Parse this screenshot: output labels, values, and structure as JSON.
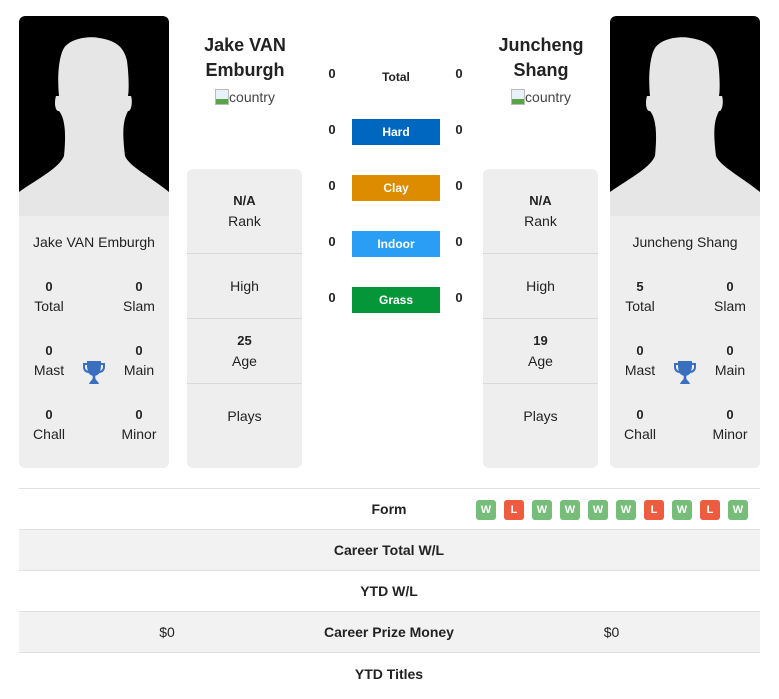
{
  "players": {
    "left": {
      "name": "Jake VAN Emburgh",
      "name_line1": "Jake VAN",
      "name_line2": "Emburgh",
      "country_alt": "country",
      "titles": {
        "total": {
          "value": "0",
          "label": "Total"
        },
        "slam": {
          "value": "0",
          "label": "Slam"
        },
        "mast": {
          "value": "0",
          "label": "Mast"
        },
        "main": {
          "value": "0",
          "label": "Main"
        },
        "chall": {
          "value": "0",
          "label": "Chall"
        },
        "minor": {
          "value": "0",
          "label": "Minor"
        }
      },
      "info": {
        "rank": {
          "value": "N/A",
          "label": "Rank"
        },
        "high": {
          "value": "",
          "label": "High"
        },
        "age": {
          "value": "25",
          "label": "Age"
        },
        "plays": {
          "value": "",
          "label": "Plays"
        }
      }
    },
    "right": {
      "name": "Juncheng Shang",
      "name_line1": "Juncheng",
      "name_line2": "Shang",
      "country_alt": "country",
      "titles": {
        "total": {
          "value": "5",
          "label": "Total"
        },
        "slam": {
          "value": "0",
          "label": "Slam"
        },
        "mast": {
          "value": "0",
          "label": "Mast"
        },
        "main": {
          "value": "0",
          "label": "Main"
        },
        "chall": {
          "value": "0",
          "label": "Chall"
        },
        "minor": {
          "value": "0",
          "label": "Minor"
        }
      },
      "info": {
        "rank": {
          "value": "N/A",
          "label": "Rank"
        },
        "high": {
          "value": "",
          "label": "High"
        },
        "age": {
          "value": "19",
          "label": "Age"
        },
        "plays": {
          "value": "",
          "label": "Plays"
        }
      }
    }
  },
  "surfaces": [
    {
      "label": "Total",
      "left": "0",
      "right": "0",
      "color": ""
    },
    {
      "label": "Hard",
      "left": "0",
      "right": "0",
      "color": "#0067c0"
    },
    {
      "label": "Clay",
      "left": "0",
      "right": "0",
      "color": "#dd8c00"
    },
    {
      "label": "Indoor",
      "left": "0",
      "right": "0",
      "color": "#2a9ef5"
    },
    {
      "label": "Grass",
      "left": "0",
      "right": "0",
      "color": "#05963a"
    }
  ],
  "stats": {
    "form": {
      "label": "Form",
      "left_results": [],
      "right_results": [
        "W",
        "L",
        "W",
        "W",
        "W",
        "W",
        "L",
        "W",
        "L",
        "W"
      ]
    },
    "career_total_wl": {
      "label": "Career Total W/L",
      "left": "",
      "right": ""
    },
    "ytd_wl": {
      "label": "YTD W/L",
      "left": "",
      "right": ""
    },
    "career_prize_money": {
      "label": "Career Prize Money",
      "left": "$0",
      "right": "$0"
    },
    "ytd_titles": {
      "label": "YTD Titles",
      "left": "",
      "right": ""
    }
  },
  "colors": {
    "win": "#76bd7a",
    "loss": "#ee5b3f",
    "trophy": "#3a6fc0"
  }
}
